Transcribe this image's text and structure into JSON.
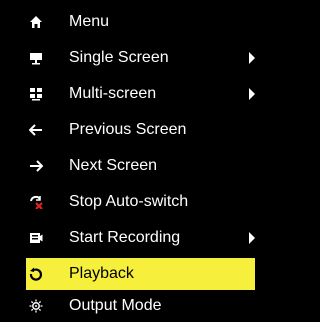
{
  "menu": {
    "items": [
      {
        "label": "Menu",
        "icon": "home-icon"
      },
      {
        "label": "Single Screen",
        "icon": "single-screen-icon",
        "submenu": true
      },
      {
        "label": "Multi-screen",
        "icon": "multi-screen-icon",
        "submenu": true
      },
      {
        "label": "Previous Screen",
        "icon": "arrow-left-icon"
      },
      {
        "label": "Next Screen",
        "icon": "arrow-right-icon"
      },
      {
        "label": "Stop Auto-switch",
        "icon": "stop-auto-switch-icon"
      },
      {
        "label": "Start Recording",
        "icon": "record-icon",
        "submenu": true
      },
      {
        "label": "Playback",
        "icon": "playback-icon",
        "highlighted": true
      },
      {
        "label": "Output Mode",
        "icon": "output-mode-icon"
      }
    ]
  },
  "colors": {
    "background": "#000000",
    "text": "#ffffff",
    "highlight": "#f6ef3c",
    "highlight_text": "#000000",
    "stop_accent": "#e02020"
  }
}
